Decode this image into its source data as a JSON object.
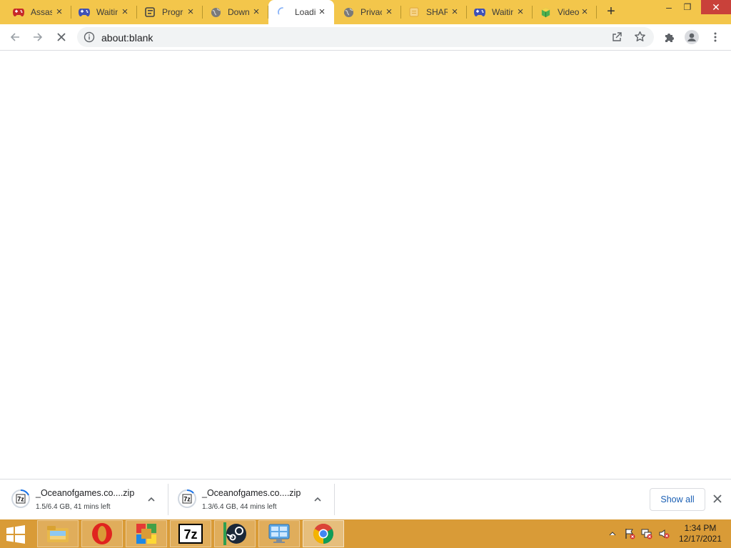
{
  "tabs": [
    {
      "title": "Assassin's Creed",
      "icon": "gamepad-red-icon",
      "active": false
    },
    {
      "title": "Waiting",
      "icon": "gamepad-blue-icon",
      "active": false
    },
    {
      "title": "Progress",
      "icon": "progress-icon",
      "active": false
    },
    {
      "title": "Download",
      "icon": "globe-icon",
      "active": false
    },
    {
      "title": "Loading",
      "icon": "loading-spinner-icon",
      "active": true
    },
    {
      "title": "Privacy",
      "icon": "globe-icon",
      "active": false
    },
    {
      "title": "SHARE",
      "icon": "file-icon",
      "active": false
    },
    {
      "title": "Waiting",
      "icon": "gamepad-blue-icon",
      "active": false
    },
    {
      "title": "Video",
      "icon": "cube-icon",
      "active": false
    }
  ],
  "window": {
    "minimize": "–",
    "restore": "❐",
    "close": "✕"
  },
  "toolbar": {
    "url": "about:blank"
  },
  "downloads": [
    {
      "name": "_Oceanofgames.co....zip",
      "status": "1.5/6.4 GB, 41 mins left",
      "icon": "7zip-archive-icon"
    },
    {
      "name": "_Oceanofgames.co....zip",
      "status": "1.3/6.4 GB, 44 mins left",
      "icon": "7zip-archive-icon"
    }
  ],
  "shelf": {
    "show_all": "Show all"
  },
  "taskbar": {
    "apps": [
      "file-explorer-icon",
      "opera-icon",
      "app-store-icon",
      "7zip-icon",
      "steam-icon",
      "control-panel-icon",
      "chrome-icon"
    ],
    "clock_time": "1:34 PM",
    "clock_date": "12/17/2021"
  },
  "colors": {
    "tabstrip": "#f3c64b",
    "taskbar": "#d99b37",
    "close": "#c9413a",
    "link": "#1a5fb4"
  }
}
